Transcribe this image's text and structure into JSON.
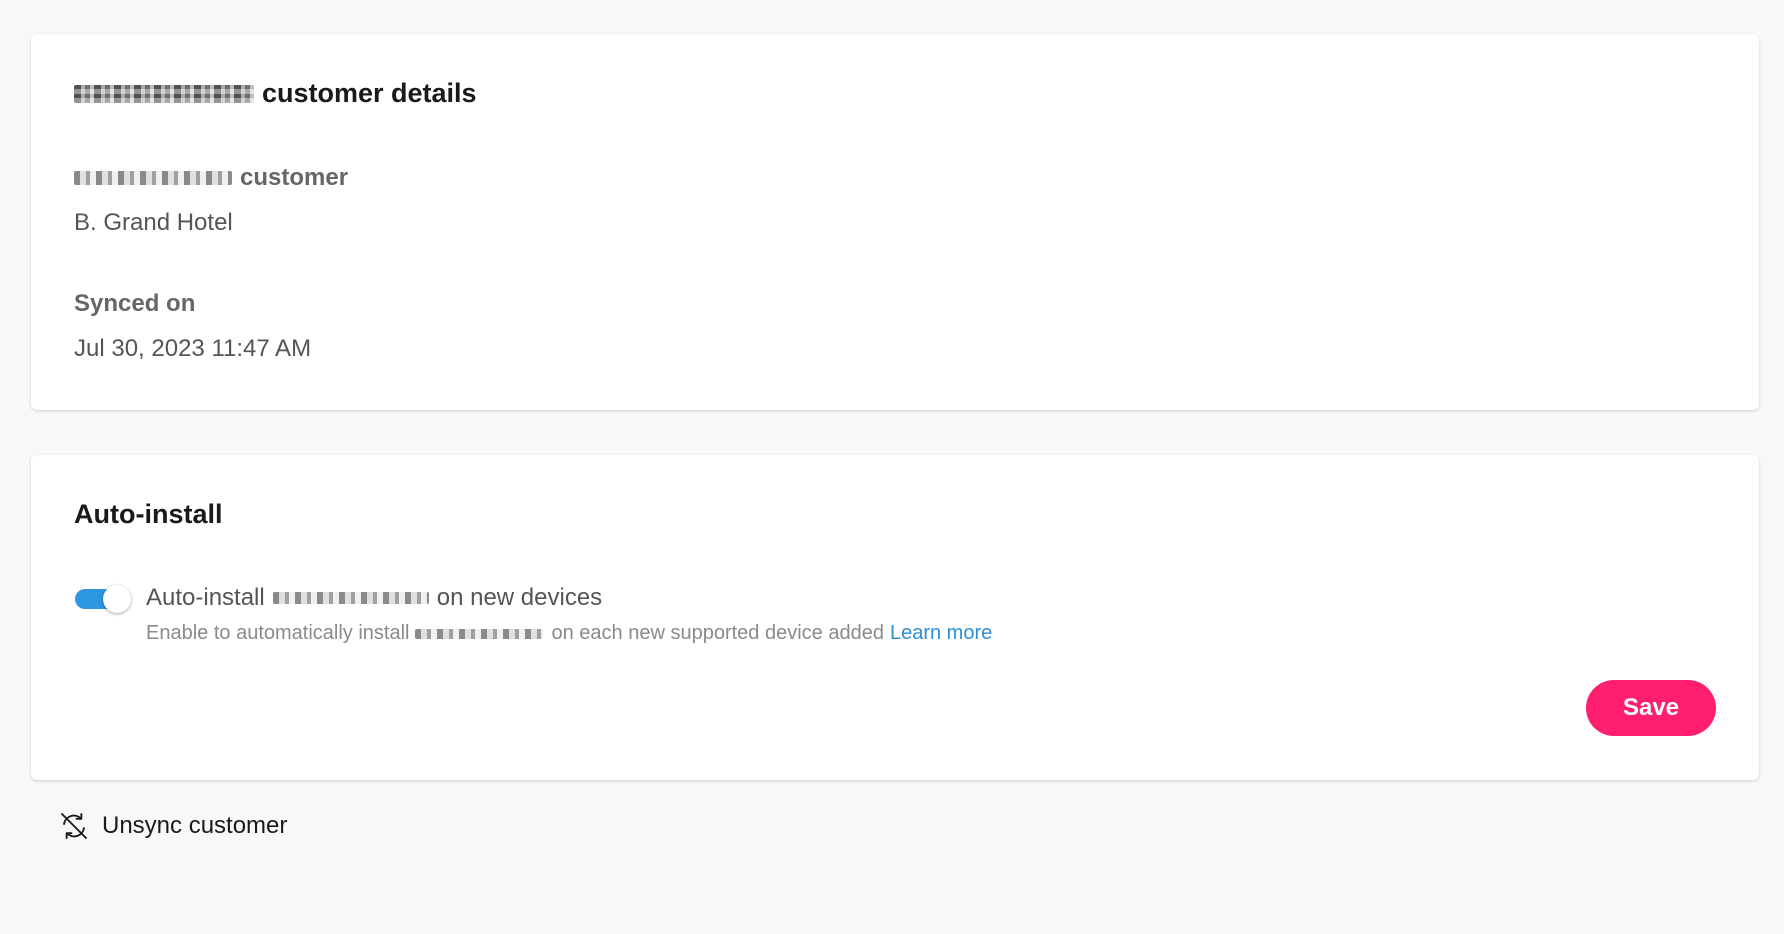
{
  "details_card": {
    "title_suffix": "customer details",
    "customer_type_suffix": "customer",
    "customer_name": "B. Grand Hotel",
    "synced_on_label": "Synced on",
    "synced_on_value": "Jul 30, 2023 11:47 AM"
  },
  "autoinstall_card": {
    "title": "Auto-install",
    "toggle_on": true,
    "setting_label_prefix": "Auto-install",
    "setting_label_suffix": "on new devices",
    "setting_desc_prefix": "Enable to automatically install",
    "setting_desc_suffix": "on each new supported device added",
    "learn_more": "Learn more",
    "save_label": "Save"
  },
  "unsync": {
    "label": "Unsync customer",
    "icon": "sync-disabled-icon"
  },
  "colors": {
    "accent_blue": "#2d96e0",
    "save_pink": "#ff1f6e",
    "link_blue": "#2b8fd6"
  }
}
